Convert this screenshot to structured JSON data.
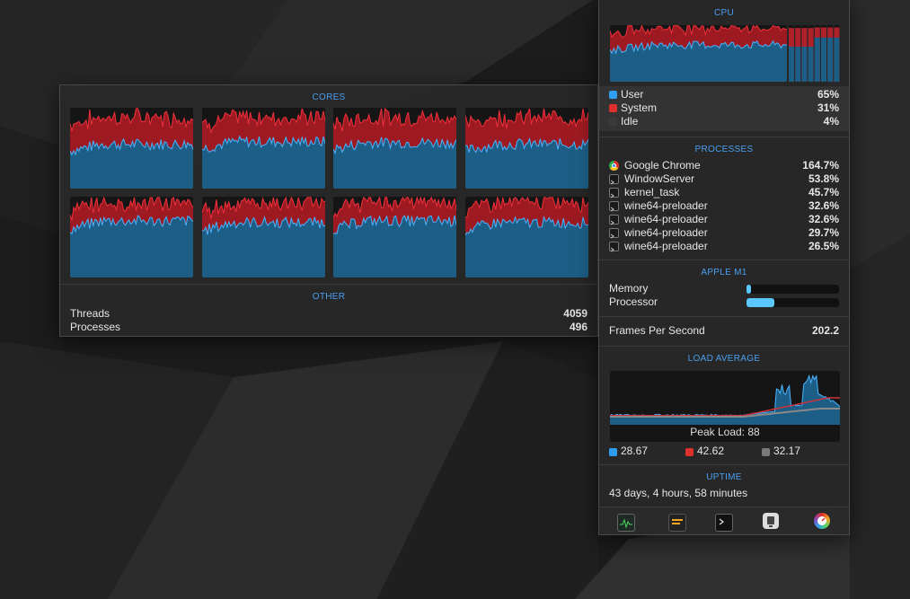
{
  "colors": {
    "user": "#2f9ef0",
    "system": "#e0302e",
    "idle": "#3a3a3a",
    "accent": "#4a9ff0"
  },
  "cores_panel": {
    "title": "CORES",
    "cores": [
      {
        "user": 0.55,
        "system": 0.33
      },
      {
        "user": 0.58,
        "system": 0.3
      },
      {
        "user": 0.57,
        "system": 0.31
      },
      {
        "user": 0.55,
        "system": 0.33
      },
      {
        "user": 0.7,
        "system": 0.22
      },
      {
        "user": 0.68,
        "system": 0.24
      },
      {
        "user": 0.7,
        "system": 0.24
      },
      {
        "user": 0.68,
        "system": 0.26
      }
    ],
    "other_title": "OTHER",
    "threads_label": "Threads",
    "threads_value": "4059",
    "processes_label": "Processes",
    "processes_value": "496"
  },
  "cpu": {
    "title": "CPU",
    "legend": [
      {
        "label": "User",
        "value": "65%",
        "color": "#2f9ef0"
      },
      {
        "label": "System",
        "value": "31%",
        "color": "#e0302e"
      },
      {
        "label": "Idle",
        "value": "4%",
        "color": "#3a3a3a"
      }
    ],
    "user": 0.65,
    "system": 0.31,
    "mini_bars": [
      {
        "user": 0.62,
        "system": 0.33
      },
      {
        "user": 0.62,
        "system": 0.33
      },
      {
        "user": 0.62,
        "system": 0.33
      },
      {
        "user": 0.62,
        "system": 0.33
      },
      {
        "user": 0.78,
        "system": 0.18
      },
      {
        "user": 0.78,
        "system": 0.18
      },
      {
        "user": 0.78,
        "system": 0.18
      },
      {
        "user": 0.78,
        "system": 0.18
      }
    ]
  },
  "processes": {
    "title": "PROCESSES",
    "items": [
      {
        "name": "Google Chrome",
        "value": "164.7%",
        "icon": "chrome-icon"
      },
      {
        "name": "WindowServer",
        "value": "53.8%",
        "icon": "terminal-icon"
      },
      {
        "name": "kernel_task",
        "value": "45.7%",
        "icon": "terminal-icon"
      },
      {
        "name": "wine64-preloader",
        "value": "32.6%",
        "icon": "terminal-icon"
      },
      {
        "name": "wine64-preloader",
        "value": "32.6%",
        "icon": "terminal-icon"
      },
      {
        "name": "wine64-preloader",
        "value": "29.7%",
        "icon": "terminal-icon"
      },
      {
        "name": "wine64-preloader",
        "value": "26.5%",
        "icon": "terminal-icon"
      }
    ]
  },
  "gpu": {
    "title": "APPLE M1",
    "memory_label": "Memory",
    "memory_fraction": 0.05,
    "processor_label": "Processor",
    "processor_fraction": 0.3
  },
  "fps": {
    "label": "Frames Per Second",
    "value": "202.2"
  },
  "load": {
    "title": "LOAD AVERAGE",
    "peak_label": "Peak Load: 88",
    "values": [
      {
        "value": "28.67",
        "color": "#2f9ef0"
      },
      {
        "value": "42.62",
        "color": "#e0302e"
      },
      {
        "value": "32.17",
        "color": "#7a7a7a"
      }
    ]
  },
  "uptime": {
    "title": "UPTIME",
    "value": "43 days, 4 hours, 58 minutes"
  },
  "tray": [
    {
      "icon": "activity-monitor-icon"
    },
    {
      "icon": "console-icon"
    },
    {
      "icon": "terminal-icon"
    },
    {
      "icon": "system-information-icon"
    },
    {
      "icon": "istat-menus-icon"
    }
  ]
}
